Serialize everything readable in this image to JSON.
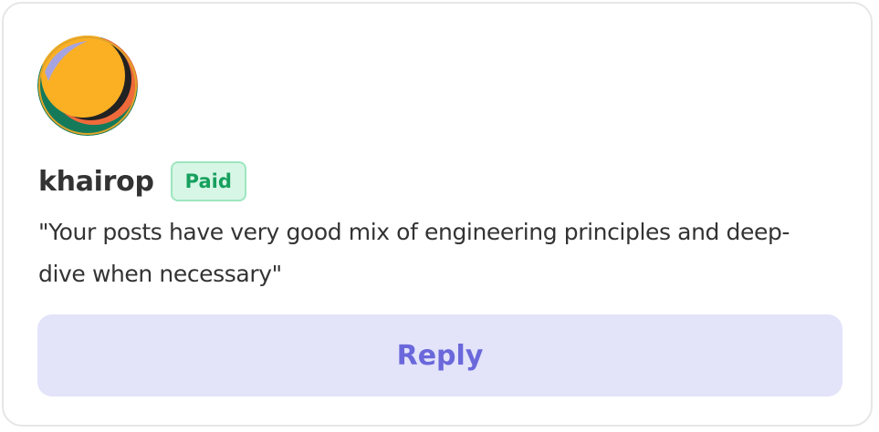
{
  "testimonial": {
    "avatar_icon": "avatar-image",
    "username": "khairop",
    "badge_label": "Paid",
    "quote": "\"Your posts have very good mix of engineering principles and deep-dive when necessary\"",
    "reply_label": "Reply"
  },
  "colors": {
    "badge_text": "#17a05d",
    "badge_bg": "#d7f6e6",
    "reply_text": "#6a68db",
    "reply_bg": "#e3e3fa"
  }
}
